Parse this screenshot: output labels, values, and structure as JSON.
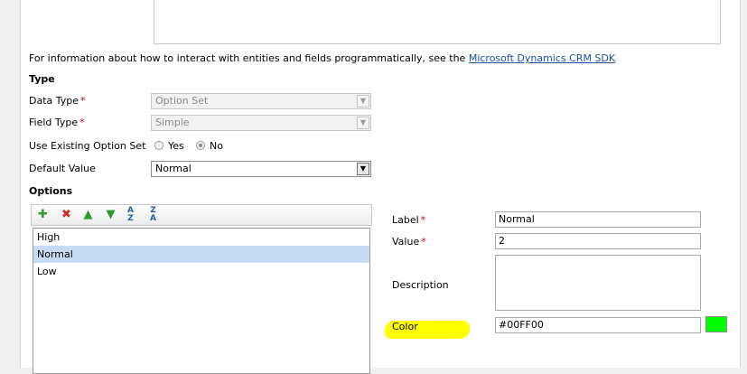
{
  "info": {
    "text": "For information about how to interact with entities and fields programmatically, see the ",
    "link": "Microsoft Dynamics CRM SDK"
  },
  "type_section": {
    "title": "Type",
    "data_type_label": "Data Type",
    "data_type_value": "Option Set",
    "field_type_label": "Field Type",
    "field_type_value": "Simple",
    "existing_label": "Use Existing Option Set",
    "yes_label": "Yes",
    "no_label": "No",
    "default_label": "Default Value",
    "default_value": "Normal"
  },
  "options_section": {
    "title": "Options",
    "items": [
      "High",
      "Normal",
      "Low"
    ]
  },
  "detail": {
    "label_label": "Label",
    "label_value": "Normal",
    "value_label": "Value",
    "value_value": "2",
    "description_label": "Description",
    "description_value": "",
    "color_label": "Color",
    "color_value": "#00FF00"
  },
  "colors": {
    "swatch": "#00FF00",
    "highlight": "#FFFF00",
    "selected_row": "#C6DCF5"
  },
  "icons": {
    "add": "add-icon",
    "delete": "delete-icon",
    "up": "arrow-up-icon",
    "down": "arrow-down-icon",
    "sort_az": "sort-az-icon",
    "sort_za": "sort-za-icon"
  }
}
